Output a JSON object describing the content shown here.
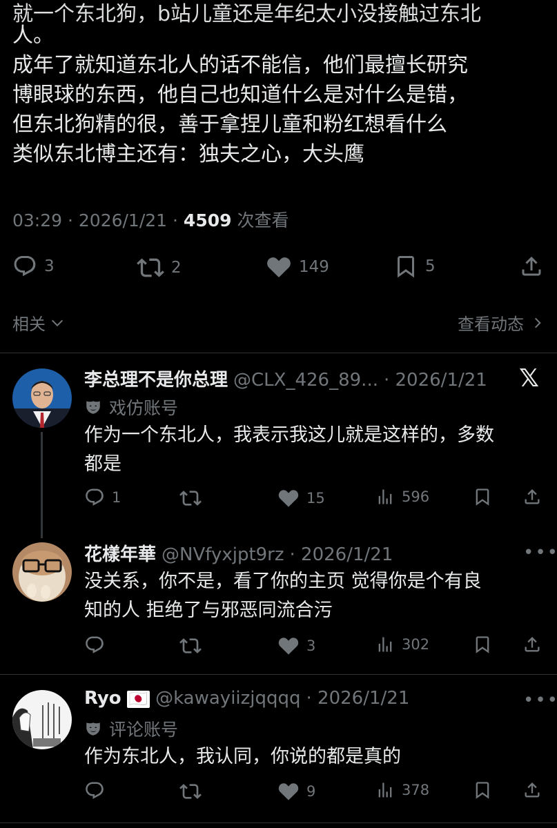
{
  "tweet": {
    "partial_line": "就一个东北狗，b站儿童还是年纪太小没接触过东北",
    "lines": [
      "人。",
      "成年了就知道东北人的话不能信，他们最擅长研究",
      "博眼球的东西，他自己也知道什么是对什么是错，",
      "但东北狗精的很，善于拿捏儿童和粉红想看什么",
      "类似东北博主还有：独夫之心，大头鹰"
    ],
    "time": "03:29 · 2026/1/21 · ",
    "views": "4509",
    "views_label": " 次查看",
    "stats": {
      "replies": "3",
      "reposts": "2",
      "likes": "149",
      "bookmarks": "5"
    }
  },
  "related": {
    "label": "相关",
    "activity": "查看动态"
  },
  "replies": [
    {
      "name": "李总理不是你总理",
      "handle": "@CLX_426_89...",
      "date": "· 2026/1/21",
      "label": "戏仿账号",
      "text_lines": [
        "作为一个东北人，我表示我这儿就是这样的，多数",
        "都是"
      ],
      "stats": {
        "replies": "1",
        "reposts": "",
        "likes": "15",
        "views": "596"
      }
    },
    {
      "name": "花樣年華",
      "handle": "@NVfyxjpt9rz",
      "date": "· 2026/1/21",
      "text_lines": [
        "没关系，你不是，看了你的主页 觉得你是个有良",
        "知的人 拒绝了与邪恶同流合污"
      ],
      "stats": {
        "replies": "",
        "reposts": "",
        "likes": "3",
        "views": "302"
      }
    },
    {
      "name": "Ryo",
      "flag": "🇯🇵",
      "handle": "@kawayiizjqqqq",
      "date": "· 2026/1/21",
      "label": "评论账号",
      "text_lines": [
        "作为东北人，我认同，你说的都是真的"
      ],
      "stats": {
        "replies": "",
        "reposts": "",
        "likes": "9",
        "views": "378"
      }
    }
  ],
  "icons": {
    "reply": "reply-icon",
    "repost": "repost-icon",
    "like": "heart-icon",
    "bookmark": "bookmark-icon",
    "share": "share-icon",
    "views": "views-icon",
    "x": "x-logo-icon",
    "more": "more-icon",
    "mask": "mask-icon"
  },
  "colors": {
    "background": "#000000",
    "text": "#e7e9ea",
    "muted": "#71767b",
    "like": "#f91880",
    "divider": "#2f3336"
  }
}
